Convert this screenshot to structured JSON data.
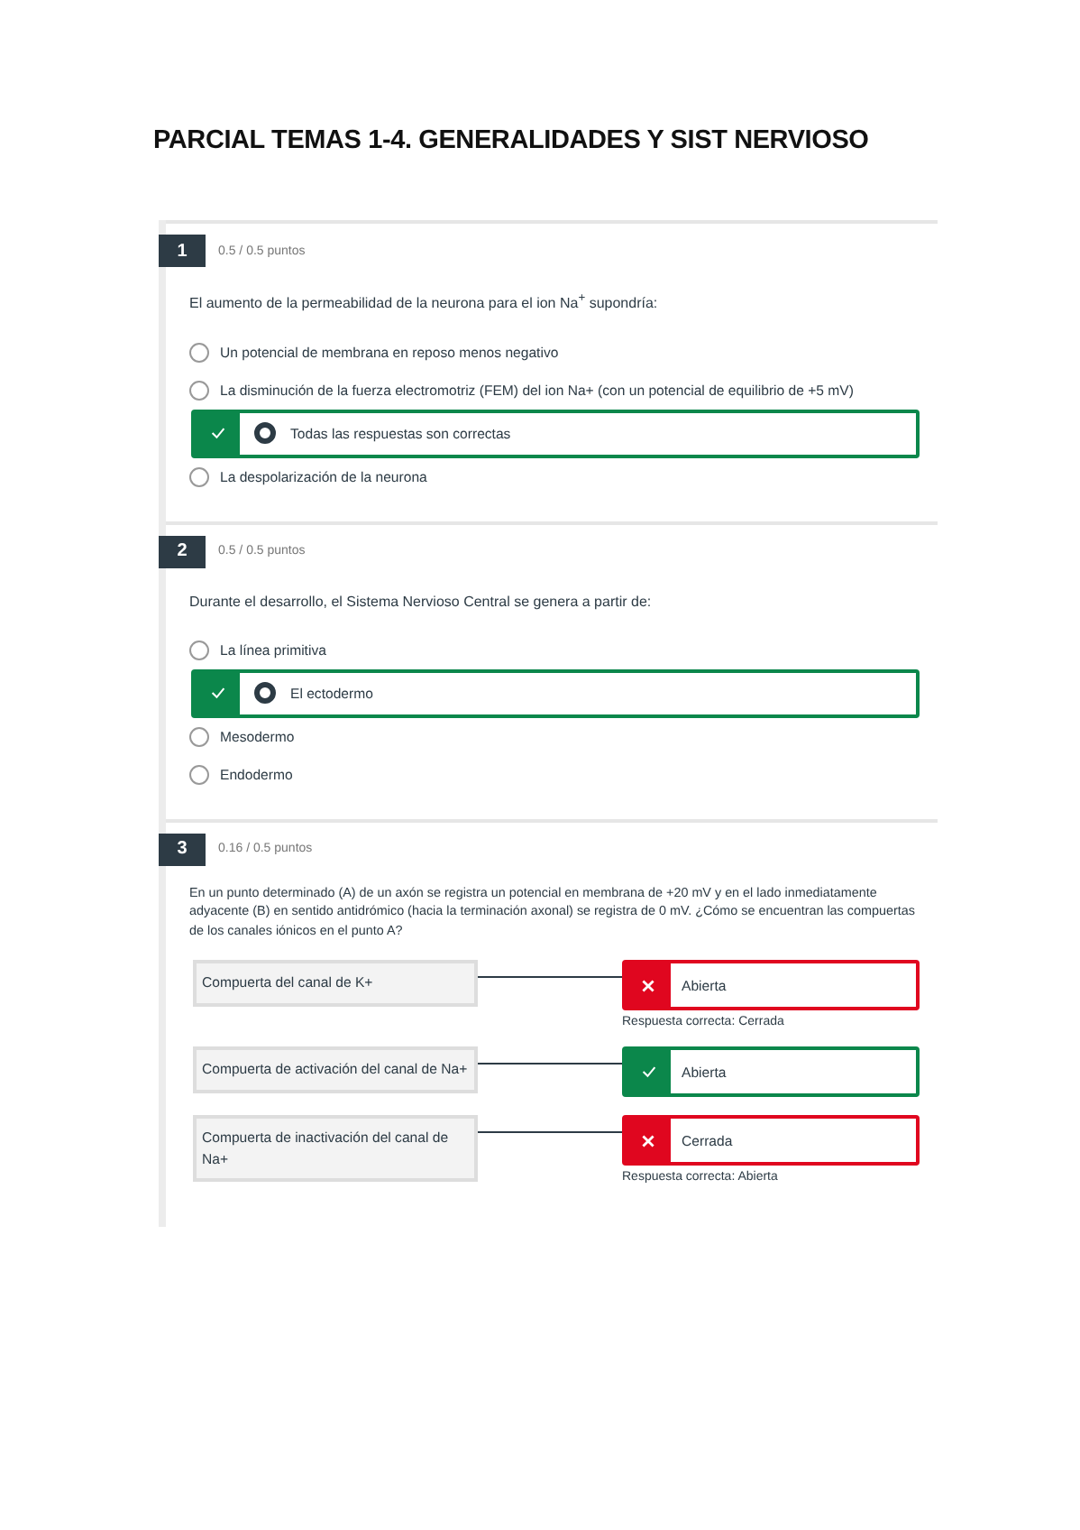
{
  "title": "PARCIAL TEMAS 1-4. GENERALIDADES Y SIST NERVIOSO",
  "questions": [
    {
      "kind": "choice",
      "number": "1",
      "points": "0.5 / 0.5 puntos",
      "text": "El aumento de la permeabilidad de la neurona para el ion Na$^{+}$ supondría:",
      "options": [
        {
          "text": "Un potencial de membrana en reposo menos negativo",
          "selected": false,
          "marked_correct": false
        },
        {
          "text": "La disminución de la fuerza electromotriz (FEM) del ion Na+ (con un potencial de equilibrio de +5 mV)",
          "selected": false,
          "marked_correct": false
        },
        {
          "text": "Todas las respuestas son correctas",
          "selected": true,
          "marked_correct": true
        },
        {
          "text": "La despolarización de la neurona",
          "selected": false,
          "marked_correct": false
        }
      ]
    },
    {
      "kind": "choice",
      "number": "2",
      "points": "0.5 / 0.5 puntos",
      "text": "Durante el desarrollo, el Sistema Nervioso Central se genera a partir de:",
      "options": [
        {
          "text": "La línea primitiva",
          "selected": false,
          "marked_correct": false
        },
        {
          "text": "El ectodermo",
          "selected": true,
          "marked_correct": true
        },
        {
          "text": "Mesodermo",
          "selected": false,
          "marked_correct": false
        },
        {
          "text": "Endodermo",
          "selected": false,
          "marked_correct": false
        }
      ]
    },
    {
      "kind": "matching",
      "number": "3",
      "points": "0.16 / 0.5 puntos",
      "text": "En un punto determinado (A) de un axón se registra un potencial en membrana de +20 mV y en el lado inmediatamente adyacente (B) en sentido antidrómico (hacia la terminación axonal) se registra de 0 mV. ¿Cómo se encuentran las compuertas de los canales iónicos en el punto A?",
      "pairs": [
        {
          "prompt": "Compuerta del canal de K+",
          "answer": "Abierta",
          "correct": false,
          "correct_label": "Respuesta correcta:",
          "correct_answer": "Cerrada"
        },
        {
          "prompt": "Compuerta de activación del canal de Na+",
          "answer": "Abierta",
          "correct": true
        },
        {
          "prompt": "Compuerta de inactivación del canal de Na+",
          "answer": "Cerrada",
          "correct": false,
          "correct_label": "Respuesta correcta:",
          "correct_answer": "Abierta"
        }
      ]
    }
  ]
}
